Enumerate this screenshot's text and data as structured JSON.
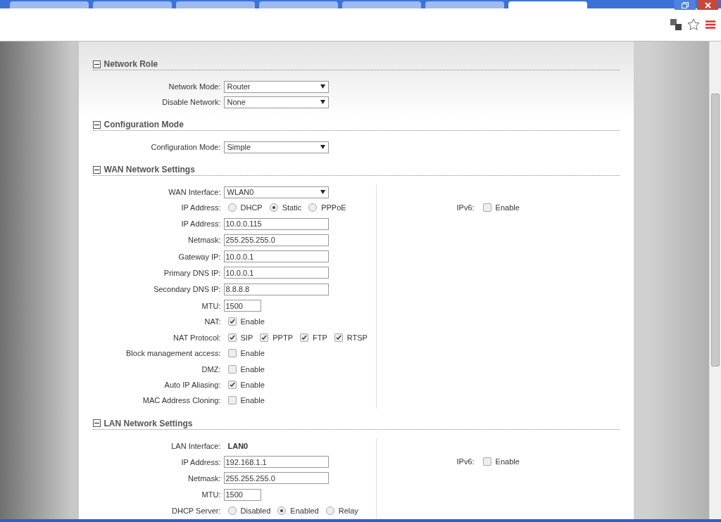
{
  "browser": {
    "tabs": [
      {
        "selected": false
      },
      {
        "selected": false
      },
      {
        "selected": false
      },
      {
        "selected": false
      },
      {
        "selected": false
      },
      {
        "selected": false
      },
      {
        "selected": true
      }
    ]
  },
  "sections": [
    {
      "title": "Network Role",
      "expanded": true,
      "rows": [
        {
          "kind": "select",
          "label": "Network Mode:",
          "value": "Router"
        },
        {
          "kind": "select",
          "label": "Disable Network:",
          "value": "None"
        }
      ]
    },
    {
      "title": "Configuration Mode",
      "expanded": true,
      "rows": [
        {
          "kind": "select",
          "label": "Configuration Mode:",
          "value": "Simple"
        }
      ]
    },
    {
      "title": "WAN Network Settings",
      "expanded": true,
      "rows": [
        {
          "kind": "select",
          "label": "WAN Interface:",
          "value": "WLAN0"
        },
        {
          "kind": "radio",
          "label": "IP Address:",
          "options": [
            {
              "label": "DHCP",
              "selected": false
            },
            {
              "label": "Static",
              "selected": true
            },
            {
              "label": "PPPoE",
              "selected": false
            }
          ]
        },
        {
          "kind": "text",
          "label": "IP Address:",
          "value": "10.0.0.115"
        },
        {
          "kind": "text",
          "label": "Netmask:",
          "value": "255.255.255.0"
        },
        {
          "kind": "text",
          "label": "Gateway IP:",
          "value": "10.0.0.1"
        },
        {
          "kind": "text",
          "label": "Primary DNS IP:",
          "value": "10.0.0.1"
        },
        {
          "kind": "text",
          "label": "Secondary DNS IP:",
          "value": "8.8.8.8"
        },
        {
          "kind": "short_text",
          "label": "MTU:",
          "value": "1500"
        },
        {
          "kind": "checks",
          "label": "NAT:",
          "options": [
            {
              "label": "Enable",
              "checked": true
            }
          ]
        },
        {
          "kind": "checks",
          "label": "NAT Protocol:",
          "options": [
            {
              "label": "SIP",
              "checked": true
            },
            {
              "label": "PPTP",
              "checked": true
            },
            {
              "label": "FTP",
              "checked": true
            },
            {
              "label": "RTSP",
              "checked": true
            }
          ]
        },
        {
          "kind": "checks",
          "label": "Block management access:",
          "options": [
            {
              "label": "Enable",
              "checked": false
            }
          ]
        },
        {
          "kind": "checks",
          "label": "DMZ:",
          "options": [
            {
              "label": "Enable",
              "checked": false
            }
          ]
        },
        {
          "kind": "checks",
          "label": "Auto IP Aliasing:",
          "options": [
            {
              "label": "Enable",
              "checked": true
            }
          ]
        },
        {
          "kind": "checks",
          "label": "MAC Address Cloning:",
          "options": [
            {
              "label": "Enable",
              "checked": false
            }
          ]
        }
      ],
      "side": [
        {
          "kind": "checks",
          "label": "IPv6:",
          "options": [
            {
              "label": "Enable",
              "checked": false
            }
          ]
        }
      ]
    },
    {
      "title": "LAN Network Settings",
      "expanded": true,
      "rows": [
        {
          "kind": "static",
          "label": "LAN Interface:",
          "value": "LAN0"
        },
        {
          "kind": "text",
          "label": "IP Address:",
          "value": "192.168.1.1"
        },
        {
          "kind": "text",
          "label": "Netmask:",
          "value": "255.255.255.0"
        },
        {
          "kind": "short_text",
          "label": "MTU:",
          "value": "1500"
        },
        {
          "kind": "radio",
          "label": "DHCP Server:",
          "options": [
            {
              "label": "Disabled",
              "selected": false
            },
            {
              "label": "Enabled",
              "selected": true
            },
            {
              "label": "Relay",
              "selected": false
            }
          ]
        }
      ],
      "side": [
        {
          "kind": "checks",
          "label": "IPv6:",
          "options": [
            {
              "label": "Enable",
              "checked": false
            }
          ]
        }
      ]
    }
  ]
}
